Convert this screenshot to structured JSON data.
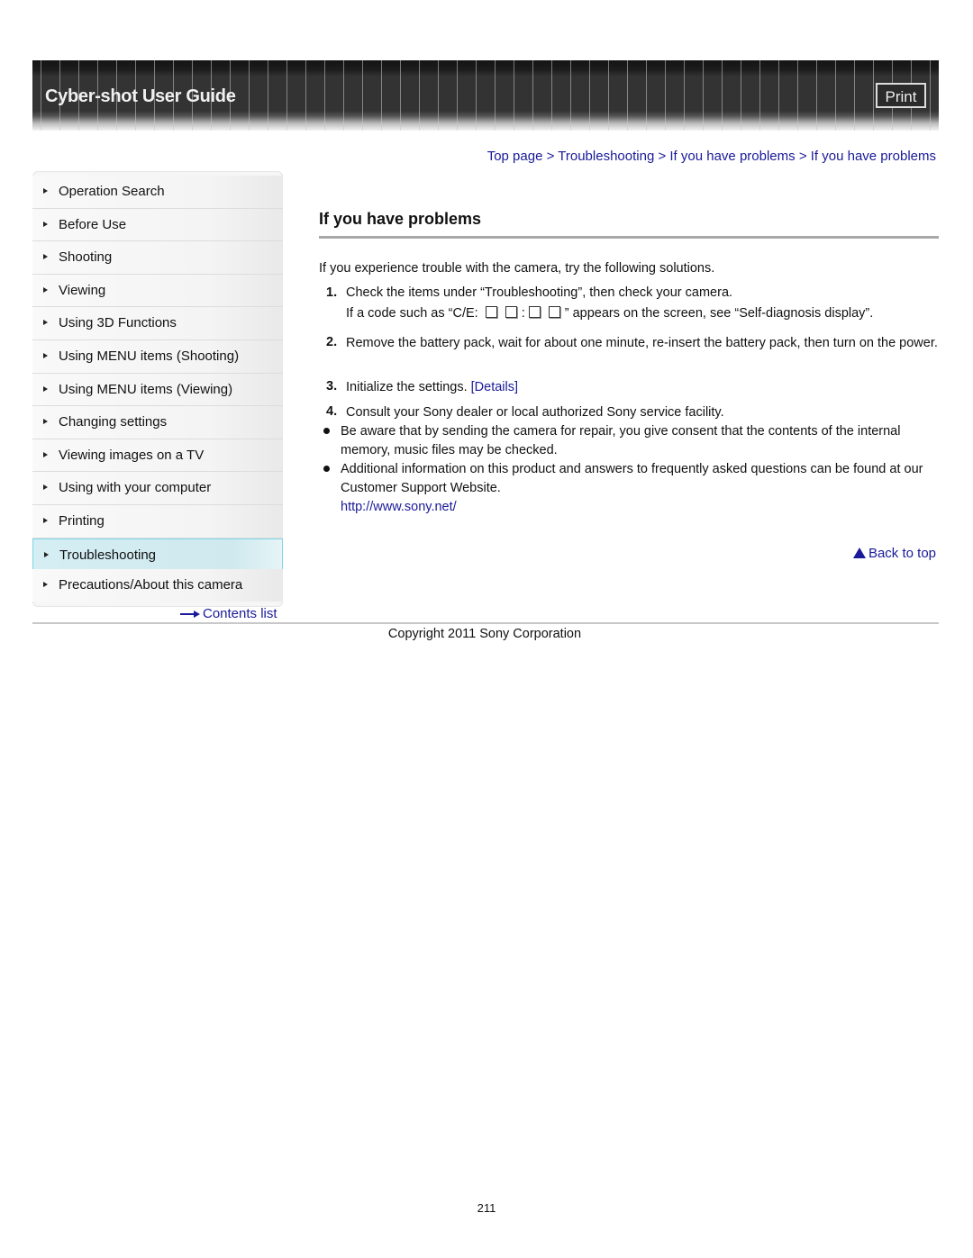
{
  "header": {
    "title": "Cyber-shot User Guide",
    "print_label": "Print"
  },
  "breadcrumb": {
    "items": [
      "Top page",
      "Troubleshooting",
      "If you have problems",
      "If you have problems"
    ],
    "separator": ">"
  },
  "sidebar": {
    "items": [
      {
        "label": "Operation Search",
        "active": false
      },
      {
        "label": "Before Use",
        "active": false
      },
      {
        "label": "Shooting",
        "active": false
      },
      {
        "label": "Viewing",
        "active": false
      },
      {
        "label": "Using 3D Functions",
        "active": false
      },
      {
        "label": "Using MENU items (Shooting)",
        "active": false
      },
      {
        "label": "Using MENU items (Viewing)",
        "active": false
      },
      {
        "label": "Changing settings",
        "active": false
      },
      {
        "label": "Viewing images on a TV",
        "active": false
      },
      {
        "label": "Using with your computer",
        "active": false
      },
      {
        "label": "Printing",
        "active": false
      },
      {
        "label": "Troubleshooting",
        "active": true
      },
      {
        "label": "Precautions/About this camera",
        "active": false
      }
    ],
    "contents_link": "Contents list"
  },
  "main": {
    "title": "If you have problems",
    "intro": "If you experience trouble with the camera, try the following solutions.",
    "steps": [
      {
        "num": "1.",
        "text": "Check the items under “Troubleshooting”, then check your camera.",
        "sub_prefix": "If a code such as “C/E: ",
        "sub_colon": ":",
        "sub_suffix": "” appears on the screen, see “Self-diagnosis display”."
      },
      {
        "num": "2.",
        "text": "Remove the battery pack, wait for about one minute, re-insert the battery pack, then turn on the power."
      },
      {
        "num": "3.",
        "text": "Initialize the settings.",
        "link": "[Details]"
      },
      {
        "num": "4.",
        "text": "Consult your Sony dealer or local authorized Sony service facility."
      }
    ],
    "bullets": [
      {
        "text": "Be aware that by sending the camera for repair, you give consent that the contents of the internal memory, music files may be checked."
      },
      {
        "text": "Additional information on this product and answers to frequently asked questions can be found at our Customer Support Website.",
        "link": "http://www.sony.net/"
      }
    ],
    "back_to_top": "Back to top"
  },
  "footer": {
    "copyright": "Copyright 2011 Sony Corporation",
    "page_number": "211"
  },
  "colors": {
    "link": "#1a1a9a",
    "active_nav_bg": "#d4eef4",
    "active_nav_border": "#7fd7ea",
    "header_bg": "#333333"
  }
}
